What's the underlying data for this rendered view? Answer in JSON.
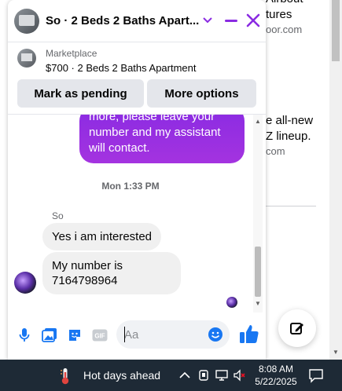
{
  "background": {
    "feed_lines": [
      {
        "text": "Airbout",
        "kind": "title"
      },
      {
        "text": "tures",
        "kind": "title"
      },
      {
        "text": "oor.com",
        "kind": "sub"
      },
      {
        "text": "e all-new",
        "kind": "title"
      },
      {
        "text": "Z lineup.",
        "kind": "title"
      },
      {
        "text": "com",
        "kind": "sub"
      }
    ],
    "compose_icon": "edit-icon"
  },
  "chat": {
    "title": "So · 2 Beds 2 Baths Apart...",
    "marketplace": {
      "label": "Marketplace",
      "listing": "$700 · 2 Beds 2 Baths Apartment",
      "mark_pending": "Mark as pending",
      "more_options": "More options"
    },
    "outgoing": {
      "lines": [
        "more, please leave your",
        "number and my assistant",
        "will contact."
      ]
    },
    "timestamp": "Mon 1:33 PM",
    "sender": "So",
    "incoming": [
      {
        "text": "Yes i am interested"
      },
      {
        "lines": [
          "My number is",
          "7164798964"
        ]
      }
    ],
    "composer": {
      "placeholder": "Aa"
    },
    "accent_color": "#8a2be2"
  },
  "taskbar": {
    "weather": "Hot days ahead",
    "time": "8:08 AM",
    "date": "5/22/2025"
  }
}
